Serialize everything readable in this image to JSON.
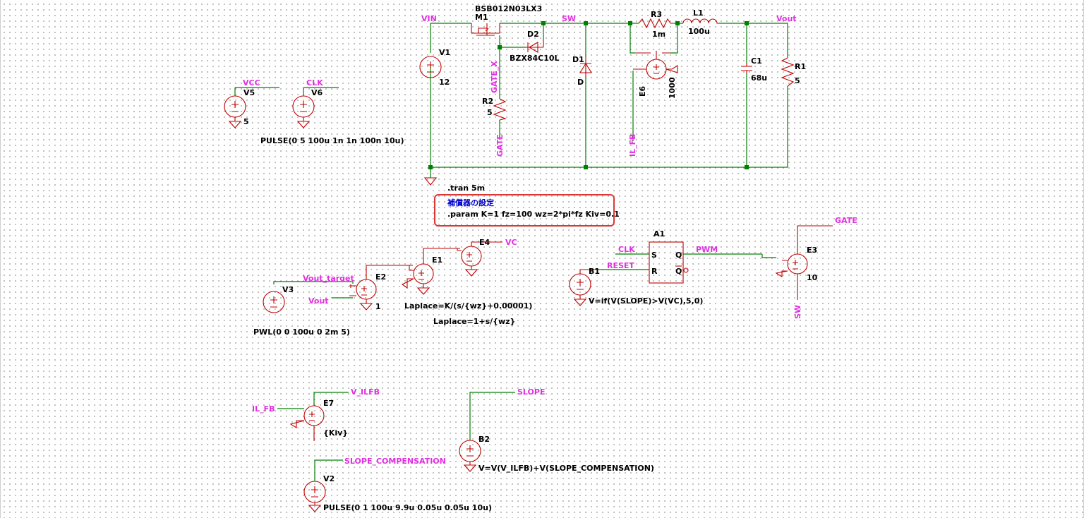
{
  "components": {
    "M1": {
      "ref": "M1",
      "value": "BSB012N03LX3"
    },
    "D2": {
      "ref": "D2",
      "value": "BZX84C10L"
    },
    "V1": {
      "ref": "V1",
      "value": "12"
    },
    "R2": {
      "ref": "R2",
      "value": "5"
    },
    "D1": {
      "ref": "D1",
      "value": "D"
    },
    "R3": {
      "ref": "R3",
      "value": "1m"
    },
    "L1": {
      "ref": "L1",
      "value": "100u"
    },
    "E6": {
      "ref": "E6",
      "value": "1000"
    },
    "C1": {
      "ref": "C1",
      "value": "68u"
    },
    "R1": {
      "ref": "R1",
      "value": "5"
    },
    "V5": {
      "ref": "V5",
      "value": "5"
    },
    "V6": {
      "ref": "V6",
      "value": "PULSE(0 5 100u 1n 1n 100n 10u)"
    },
    "V3": {
      "ref": "V3",
      "value": "PWL(0 0 100u 0 2m 5)"
    },
    "E2": {
      "ref": "E2",
      "value": "1"
    },
    "E1": {
      "ref": "E1",
      "value": "Laplace=K/(s/{wz}+0.00001)"
    },
    "E4": {
      "ref": "E4",
      "value": "Laplace=1+s/{wz}"
    },
    "A1": {
      "ref": "A1"
    },
    "B1": {
      "ref": "B1",
      "value": "V=if(V(SLOPE)>V(VC),5,0)"
    },
    "E3": {
      "ref": "E3",
      "value": "10"
    },
    "E7": {
      "ref": "E7",
      "value": "{Kiv}"
    },
    "B2": {
      "ref": "B2",
      "value": "V=V(V_ILFB)+V(SLOPE_COMPENSATION)"
    },
    "V2": {
      "ref": "V2",
      "value": "PULSE(0 1 100u 9.9u 0.05u 0.05u 10u)"
    }
  },
  "nets": {
    "vin": "VIN",
    "sw": "SW",
    "vout": "Vout",
    "vcc": "VCC",
    "clk": "CLK",
    "gate_x": "GATE_X",
    "gate": "GATE",
    "il_fb": "IL_FB",
    "vout_target": "Vout_target",
    "vout2": "Vout",
    "vc": "VC",
    "clk2": "CLK",
    "reset": "RESET",
    "pwm": "PWM",
    "gate2": "GATE",
    "sw2": "SW",
    "il_fb2": "IL_FB",
    "v_ilfb": "V_ILFB",
    "slope": "SLOPE",
    "slope_comp": "SLOPE_COMPENSATION"
  },
  "directives": {
    "tran": ".tran 5m",
    "comment": "補償器の設定",
    "param": ".param K=1 fz=100 wz=2*pi*fz Kiv=0.1"
  },
  "pins": {
    "s": "S",
    "r": "R",
    "q": "Q",
    "qbar": "Q"
  }
}
